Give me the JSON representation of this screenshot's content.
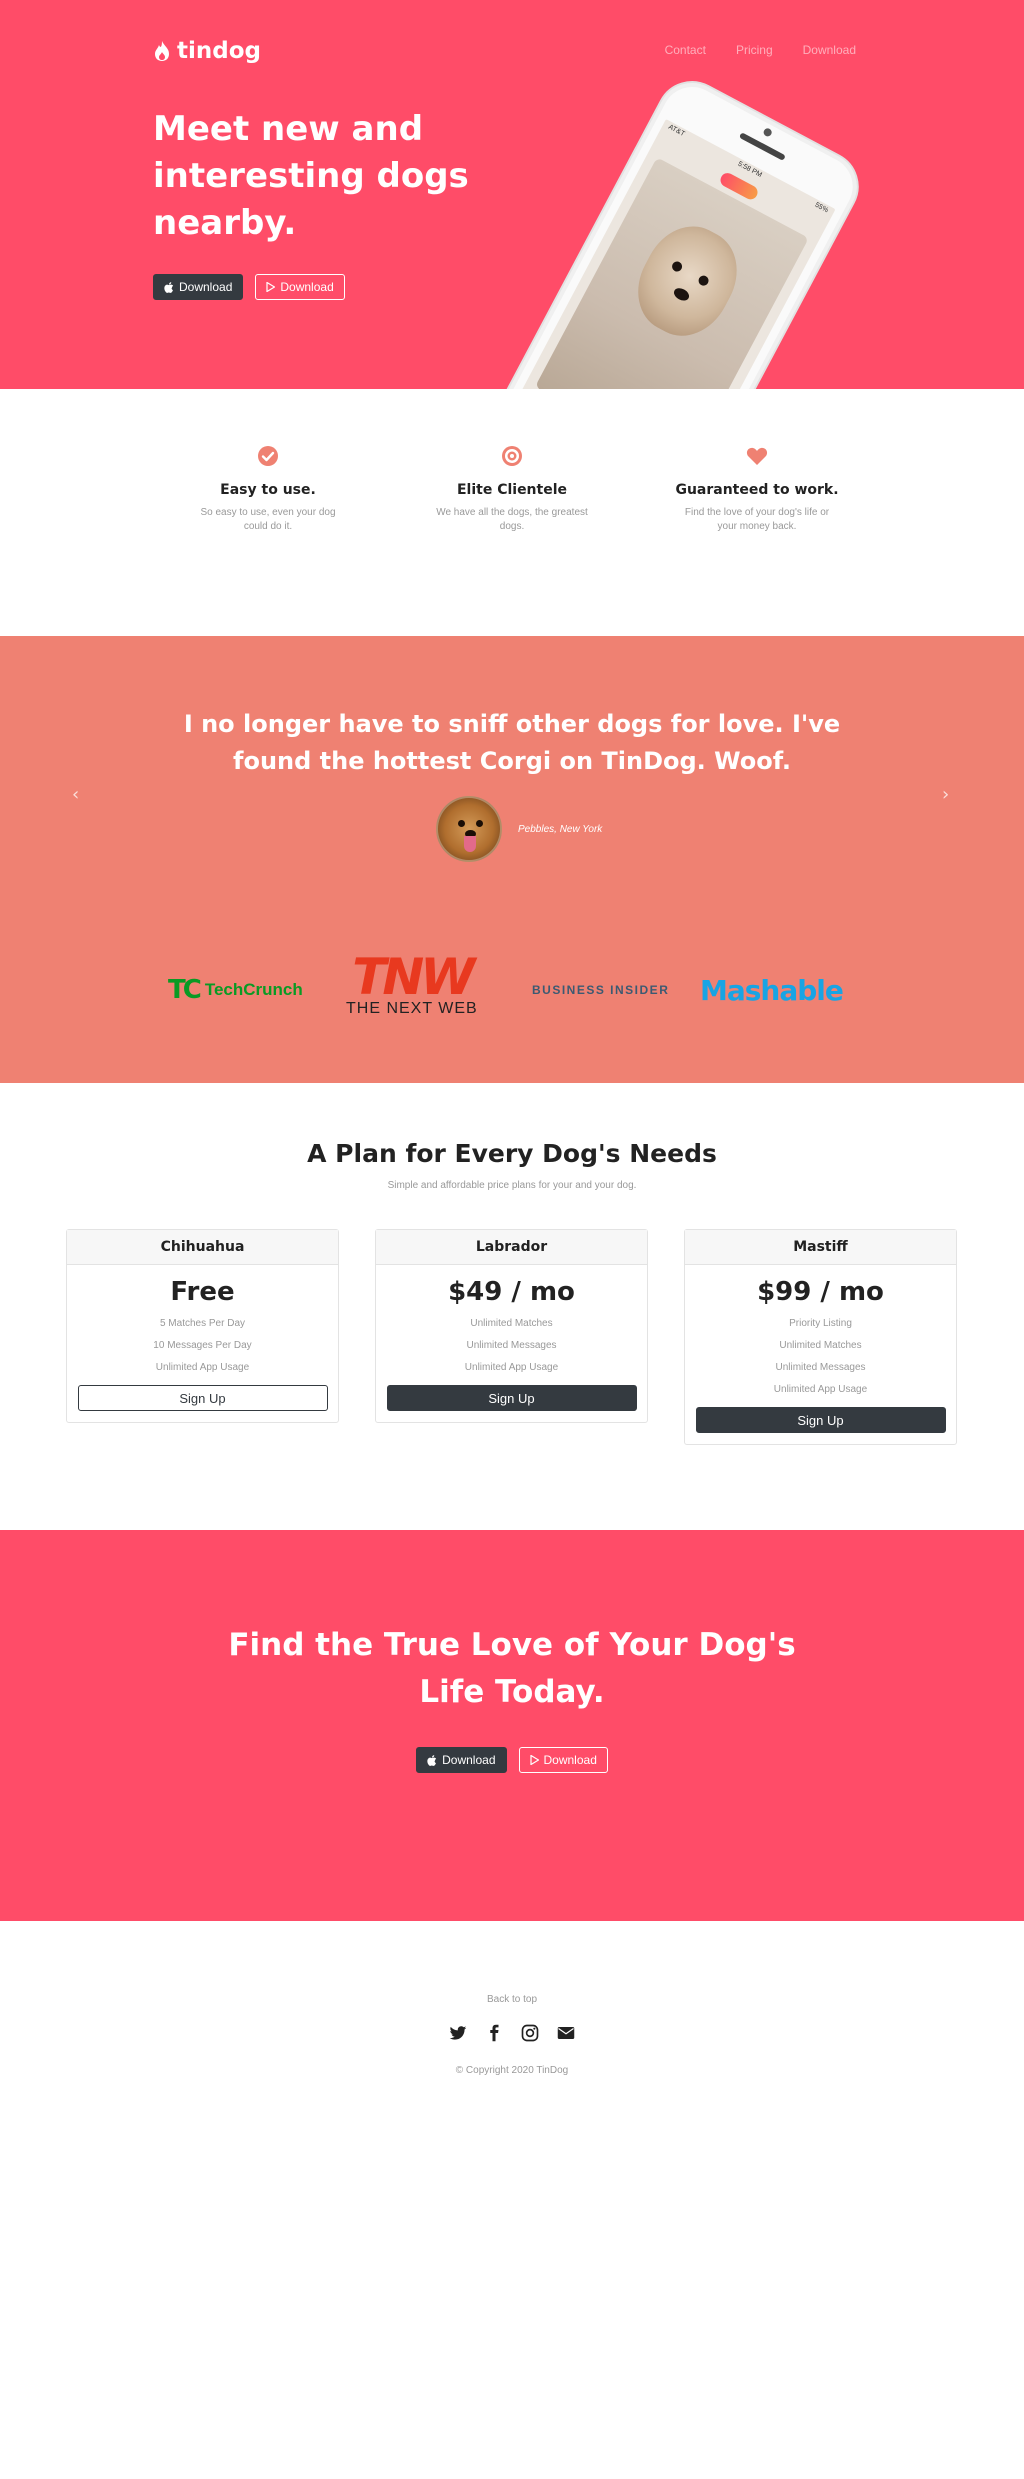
{
  "brand": {
    "name": "tindog"
  },
  "nav": {
    "items": [
      "Contact",
      "Pricing",
      "Download"
    ]
  },
  "hero": {
    "headline": "Meet new and interesting dogs nearby.",
    "apple_button": "Download",
    "play_button": "Download",
    "phone_status": {
      "carrier": "AT&T",
      "time": "5:58 PM",
      "battery": "55%"
    }
  },
  "features": [
    {
      "icon": "check-circle-icon",
      "title": "Easy to use.",
      "text": "So easy to use, even your dog could do it."
    },
    {
      "icon": "bullseye-icon",
      "title": "Elite Clientele",
      "text": "We have all the dogs, the greatest dogs."
    },
    {
      "icon": "heart-icon",
      "title": "Guaranteed to work.",
      "text": "Find the love of your dog's life or your money back."
    }
  ],
  "testimonial": {
    "quote": "I no longer have to sniff other dogs for love. I've found the hottest Corgi on TinDog. Woof.",
    "attribution": "Pebbles, New York",
    "prev_arrow": "‹",
    "next_arrow": "›"
  },
  "press": {
    "techcrunch_mark": "TC",
    "techcrunch_text": "TechCrunch",
    "tnw_mark": "TNW",
    "tnw_text": "THE NEXT WEB",
    "business_insider": "BUSINESS INSIDER",
    "mashable": "Mashable"
  },
  "pricing": {
    "title": "A Plan for Every Dog's Needs",
    "subtitle": "Simple and affordable price plans for your and your dog.",
    "plans": [
      {
        "name": "Chihuahua",
        "price": "Free",
        "features": [
          "5 Matches Per Day",
          "10 Messages Per Day",
          "Unlimited App Usage"
        ],
        "button": "Sign Up"
      },
      {
        "name": "Labrador",
        "price": "$49 / mo",
        "features": [
          "Unlimited Matches",
          "Unlimited Messages",
          "Unlimited App Usage"
        ],
        "button": "Sign Up"
      },
      {
        "name": "Mastiff",
        "price": "$99 / mo",
        "features": [
          "Priority Listing",
          "Unlimited Matches",
          "Unlimited Messages",
          "Unlimited App Usage"
        ],
        "button": "Sign Up"
      }
    ]
  },
  "cta": {
    "headline": "Find the True Love of Your Dog's Life Today.",
    "apple_button": "Download",
    "play_button": "Download"
  },
  "footer": {
    "back_to_top": "Back to top",
    "social": [
      "twitter-icon",
      "facebook-icon",
      "instagram-icon",
      "envelope-icon"
    ],
    "copyright": "© Copyright 2020 TinDog"
  },
  "colors": {
    "hero": "#ff4c68",
    "testimonial": "#ef8172",
    "dark": "#343a40",
    "accent_icon": "#ef8172"
  }
}
